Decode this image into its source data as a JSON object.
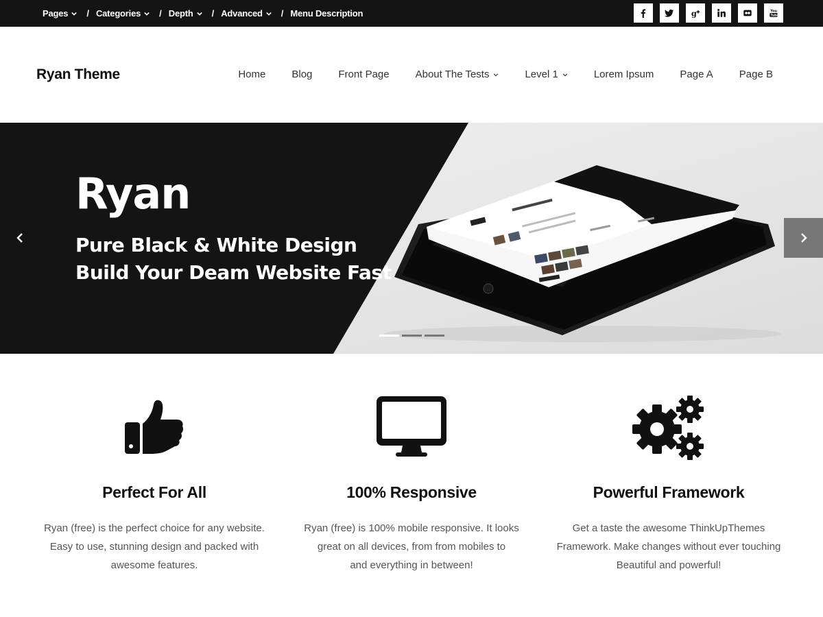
{
  "topbar": {
    "menu": [
      {
        "label": "Pages",
        "dropdown": true
      },
      {
        "label": "Categories",
        "dropdown": true
      },
      {
        "label": "Depth",
        "dropdown": true
      },
      {
        "label": "Advanced",
        "dropdown": true
      },
      {
        "label": "Menu Description",
        "dropdown": false
      }
    ],
    "separator": "/",
    "social_icons": [
      "facebook-icon",
      "twitter-icon",
      "google-plus-icon",
      "linkedin-icon",
      "flickr-icon",
      "youtube-icon"
    ]
  },
  "header": {
    "site_title": "Ryan Theme",
    "nav": [
      {
        "label": "Home",
        "dropdown": false
      },
      {
        "label": "Blog",
        "dropdown": false
      },
      {
        "label": "Front Page",
        "dropdown": false
      },
      {
        "label": "About The Tests",
        "dropdown": true
      },
      {
        "label": "Level 1",
        "dropdown": true
      },
      {
        "label": "Lorem Ipsum",
        "dropdown": false
      },
      {
        "label": "Page A",
        "dropdown": false
      },
      {
        "label": "Page B",
        "dropdown": false
      }
    ]
  },
  "slider": {
    "title": "Ryan",
    "line1": "Pure Black & White Design",
    "line2": "Build Your Deam Website Fast",
    "prev_icon": "chevron-left-icon",
    "next_icon": "chevron-right-icon",
    "slide_count": 3,
    "active_slide": 1
  },
  "features": [
    {
      "icon": "thumbs-up-icon",
      "title": "Perfect For All",
      "lines": [
        "Ryan (free) is the perfect choice for any website.",
        "Easy to use, stunning design and packed with",
        "awesome features."
      ]
    },
    {
      "icon": "monitor-icon",
      "title": "100% Responsive",
      "lines": [
        "Ryan (free) is 100% mobile responsive. It looks",
        "great on all devices, from from mobiles to",
        "and everything in between!"
      ]
    },
    {
      "icon": "gears-icon",
      "title": "Powerful Framework",
      "lines": [
        "Get a taste the awesome ThinkUpThemes",
        "Framework. Make changes without ever touching",
        "Beautiful and powerful!"
      ]
    }
  ],
  "colors": {
    "dark": "#141414",
    "white": "#ffffff",
    "slider_light": "#e9e9e9",
    "arrow_next": "#777777",
    "body_text": "#555555"
  }
}
